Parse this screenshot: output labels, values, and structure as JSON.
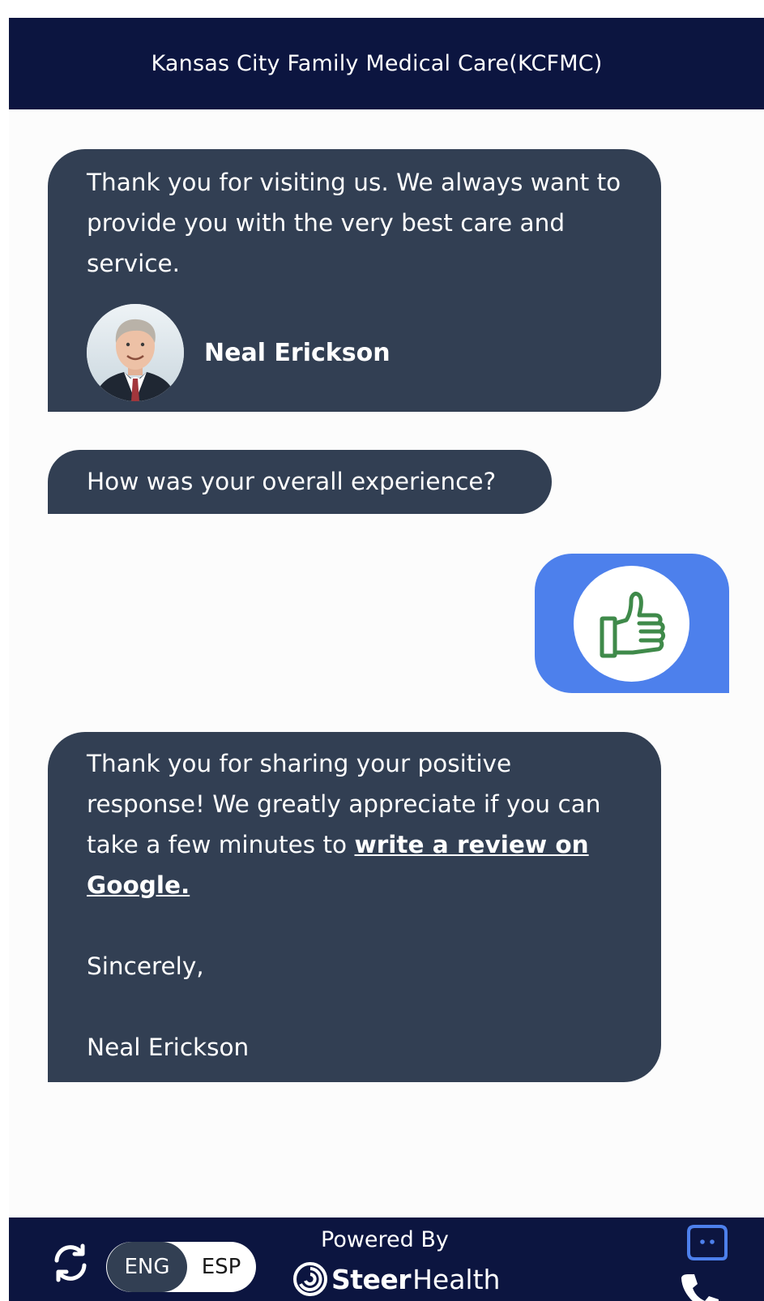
{
  "header": {
    "title": "Kansas City Family Medical Care(KCFMC)"
  },
  "messages": {
    "greeting": {
      "text": "Thank you for visiting us. We always want to provide you with the very best care and service.",
      "sender_name": "Neal Erickson"
    },
    "question": {
      "text": "How was your overall experience?"
    },
    "user_response": {
      "icon": "thumbs-up-icon",
      "icon_color": "#3f8a4a"
    },
    "thanks": {
      "text_before_link": "Thank you for sharing your positive response! We greatly appreciate if you can take a few minutes to ",
      "link_text": "write a review on Google.",
      "closing": "Sincerely,",
      "signature": "Neal Erickson"
    }
  },
  "footer": {
    "refresh_icon": "refresh-icon",
    "lang_eng": "ENG",
    "lang_esp": "ESP",
    "selected_language": "ENG",
    "powered_by": "Powered By",
    "brand_steer": "Steer",
    "brand_health": "Health",
    "chat_icon": "chat-icon",
    "phone_icon": "phone-icon"
  },
  "colors": {
    "header_bg": "#0c1540",
    "bot_bubble": "#323f53",
    "user_bubble": "#4d80ec",
    "page_bg": "#fcfcfc"
  }
}
